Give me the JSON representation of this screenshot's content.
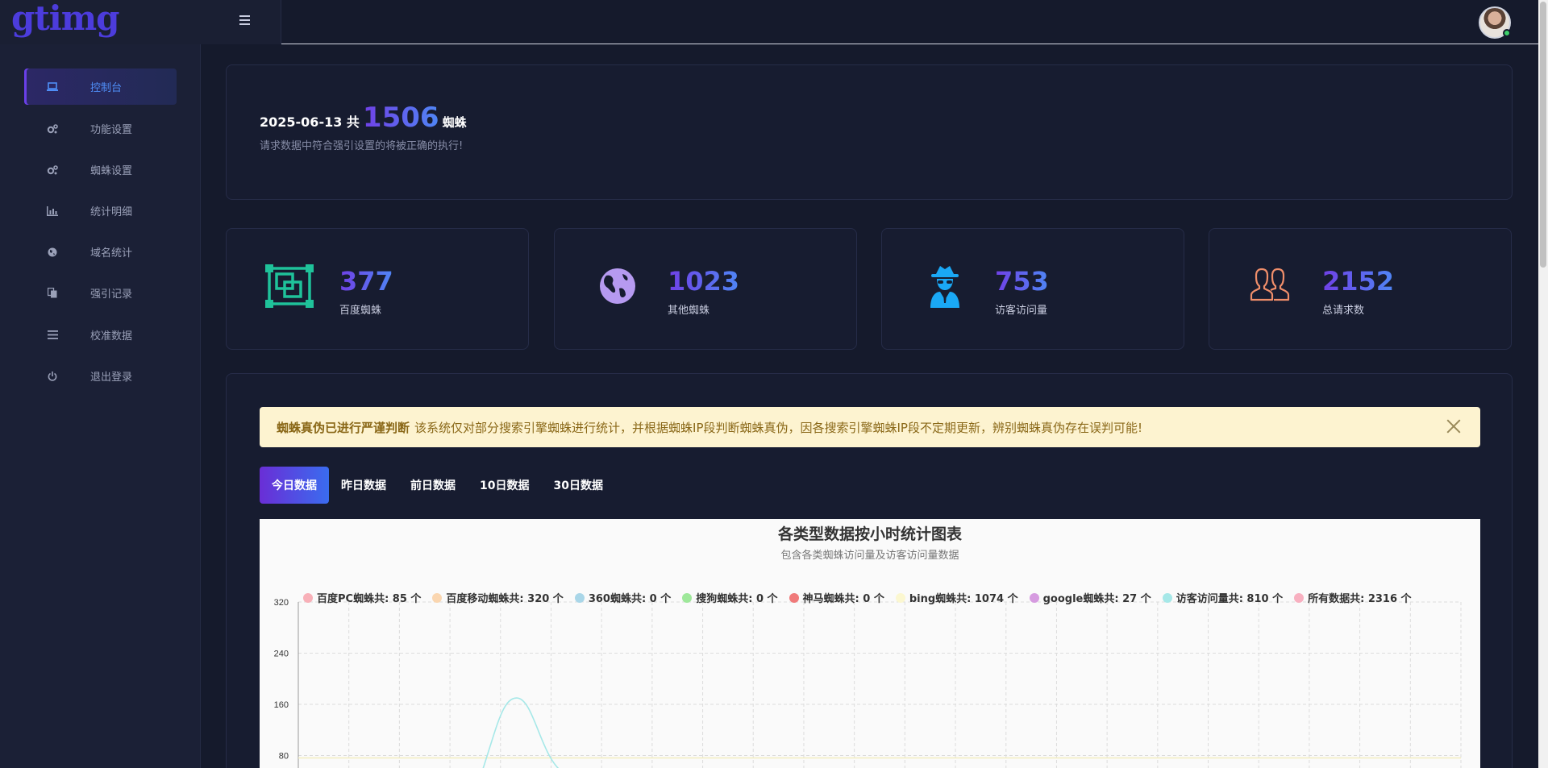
{
  "app": {
    "logo": "gtimg"
  },
  "sidebar": {
    "items": [
      {
        "label": "控制台",
        "icon": "laptop-icon",
        "active": true
      },
      {
        "label": "功能设置",
        "icon": "gears-icon"
      },
      {
        "label": "蜘蛛设置",
        "icon": "gears-icon"
      },
      {
        "label": "统计明细",
        "icon": "bar-chart-icon"
      },
      {
        "label": "域名统计",
        "icon": "globe-icon"
      },
      {
        "label": "强引记录",
        "icon": "copy-icon"
      },
      {
        "label": "校准数据",
        "icon": "list-icon"
      },
      {
        "label": "退出登录",
        "icon": "power-icon"
      }
    ]
  },
  "banner": {
    "date": "2025-06-13 共",
    "count": "1506",
    "unit": "蜘蛛",
    "note": "请求数据中符合强引设置的将被正确的执行!"
  },
  "stats": [
    {
      "value": "377",
      "label": "百度蜘蛛",
      "icon": "frame-icon",
      "color": "#1fc29a"
    },
    {
      "value": "1023",
      "label": "其他蜘蛛",
      "icon": "earth-icon",
      "color": "#b69af0"
    },
    {
      "value": "753",
      "label": "访客访问量",
      "icon": "spy-icon",
      "color": "#1aa8f5"
    },
    {
      "value": "2152",
      "label": "总请求数",
      "icon": "users-icon",
      "color": "#f08e6a"
    }
  ],
  "alert": {
    "strong": "蜘蛛真伪已进行严谨判断",
    "text": "该系统仅对部分搜索引擎蜘蛛进行统计，并根据蜘蛛IP段判断蜘蛛真伪，因各搜索引擎蜘蛛IP段不定期更新，辨别蜘蛛真伪存在误判可能!"
  },
  "tabs": [
    {
      "label": "今日数据",
      "active": true
    },
    {
      "label": "昨日数据"
    },
    {
      "label": "前日数据"
    },
    {
      "label": "10日数据"
    },
    {
      "label": "30日数据"
    }
  ],
  "chart_data": {
    "type": "line",
    "title": "各类型数据按小时统计图表",
    "subtitle": "包含各类蜘蛛访问量及访客访问量数据",
    "ylim": [
      0,
      320
    ],
    "yticks": [
      "320",
      "240",
      "160",
      "80"
    ],
    "grid": true,
    "legend_position": "top",
    "series": [
      {
        "name": "百度PC蜘蛛共: 85 个",
        "color": "#f8b0b8"
      },
      {
        "name": "百度移动蜘蛛共: 320 个",
        "color": "#fad6b0"
      },
      {
        "name": "360蜘蛛共: 0 个",
        "color": "#a9d6e8"
      },
      {
        "name": "搜狗蜘蛛共: 0 个",
        "color": "#9ee89a"
      },
      {
        "name": "神马蜘蛛共: 0 个",
        "color": "#f07a7a"
      },
      {
        "name": "bing蜘蛛共: 1074 个",
        "color": "#fbf7d0"
      },
      {
        "name": "google蜘蛛共: 27 个",
        "color": "#d69be0"
      },
      {
        "name": "访客访问量共: 810 个",
        "color": "#a6e8e8",
        "peak_value": 170
      },
      {
        "name": "所有数据共: 2316 个",
        "color": "#f8b0c0"
      }
    ]
  }
}
